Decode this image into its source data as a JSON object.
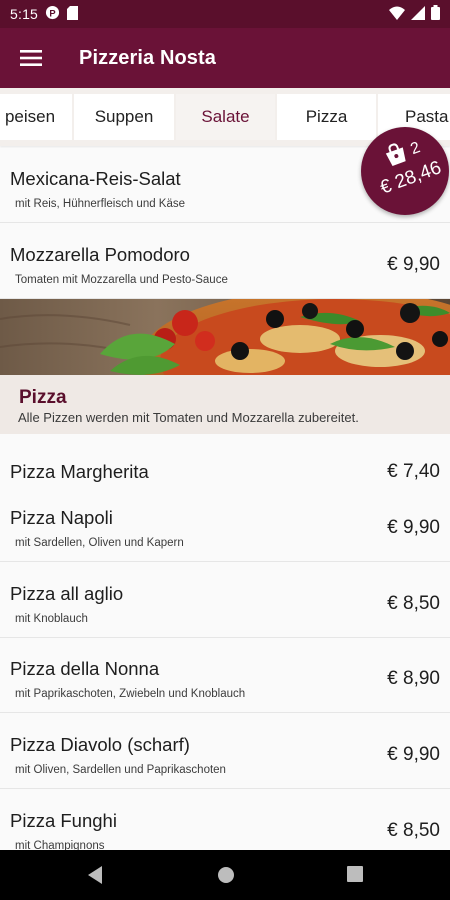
{
  "status_bar": {
    "time": "5:15",
    "icons_left": [
      "p-badge-icon",
      "sd-card-icon"
    ],
    "icons_right": [
      "wifi-icon",
      "cellular-signal-icon",
      "battery-icon"
    ]
  },
  "app_bar": {
    "title": "Pizzeria Nosta",
    "menu_icon": "hamburger-menu-icon"
  },
  "tabs": [
    {
      "label": "Vorspeisen",
      "visible_text": "peisen"
    },
    {
      "label": "Suppen"
    },
    {
      "label": "Salate",
      "active": true
    },
    {
      "label": "Pizza"
    },
    {
      "label": "Pasta"
    }
  ],
  "salads": [
    {
      "name": "Mexicana-Reis-Salat",
      "desc": "mit Reis, Hühnerfleisch und Käse",
      "price": ""
    },
    {
      "name": "Mozzarella Pomodoro",
      "desc": "Tomaten mit Mozzarella und Pesto-Sauce",
      "price": "€ 9,90"
    }
  ],
  "pizza_section": {
    "title": "Pizza",
    "desc": "Alle Pizzen werden mit Tomaten und Mozzarella zubereitet.",
    "items": [
      {
        "name": "Pizza Margherita",
        "desc": "",
        "price": "€ 7,40"
      },
      {
        "name": "Pizza Napoli",
        "desc": "mit Sardellen, Oliven und Kapern",
        "price": "€ 9,90"
      },
      {
        "name": "Pizza all aglio",
        "desc": "mit Knoblauch",
        "price": "€ 8,50"
      },
      {
        "name": "Pizza della Nonna",
        "desc": "mit Paprikaschoten, Zwiebeln und Knoblauch",
        "price": "€ 8,90"
      },
      {
        "name": "Pizza Diavolo (scharf)",
        "desc": "mit Oliven, Sardellen und Paprikaschoten",
        "price": "€ 9,90"
      },
      {
        "name": "Pizza Funghi",
        "desc": "mit Champignons",
        "price": "€ 8,50"
      }
    ]
  },
  "cart": {
    "count": "2",
    "total": "€ 28,46",
    "icon": "shopping-bag-icon"
  },
  "nav_bar": {
    "buttons": [
      "back-icon",
      "home-icon",
      "recents-icon"
    ]
  },
  "colors": {
    "primary": "#6a1237",
    "primary_dark": "#5a0f2c",
    "tab_bg": "#f3efec",
    "section_bg": "#efe9e5"
  }
}
